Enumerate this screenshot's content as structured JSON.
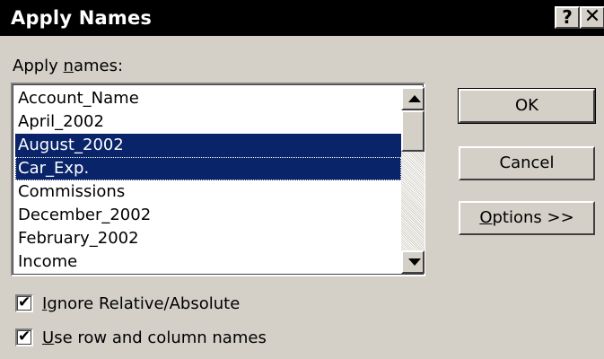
{
  "window": {
    "title": "Apply Names",
    "help_glyph": "?",
    "close_glyph": "✕"
  },
  "apply_names": {
    "label_prefix": "Apply ",
    "label_accel": "n",
    "label_suffix": "ames:",
    "items": [
      {
        "label": "Account_Name",
        "selected": false
      },
      {
        "label": "April_2002",
        "selected": false
      },
      {
        "label": "August_2002",
        "selected": true
      },
      {
        "label": "Car_Exp.",
        "selected": true
      },
      {
        "label": "Commissions",
        "selected": false
      },
      {
        "label": "December_2002",
        "selected": false
      },
      {
        "label": "February_2002",
        "selected": false
      },
      {
        "label": "Income",
        "selected": false
      }
    ]
  },
  "buttons": {
    "ok": "OK",
    "cancel": "Cancel",
    "options_accel": "O",
    "options_rest": "ptions >>"
  },
  "checkboxes": {
    "ignore_relative": {
      "accel": "I",
      "rest": "gnore Relative/Absolute",
      "checked": true
    },
    "use_row_column": {
      "accel": "U",
      "rest": "se row and column names",
      "checked": true
    }
  },
  "glyphs": {
    "checkmark": "✔"
  },
  "colors": {
    "dialog_face": "#d4d0c8",
    "title_bar": "#000000",
    "selection": "#0a246a"
  }
}
